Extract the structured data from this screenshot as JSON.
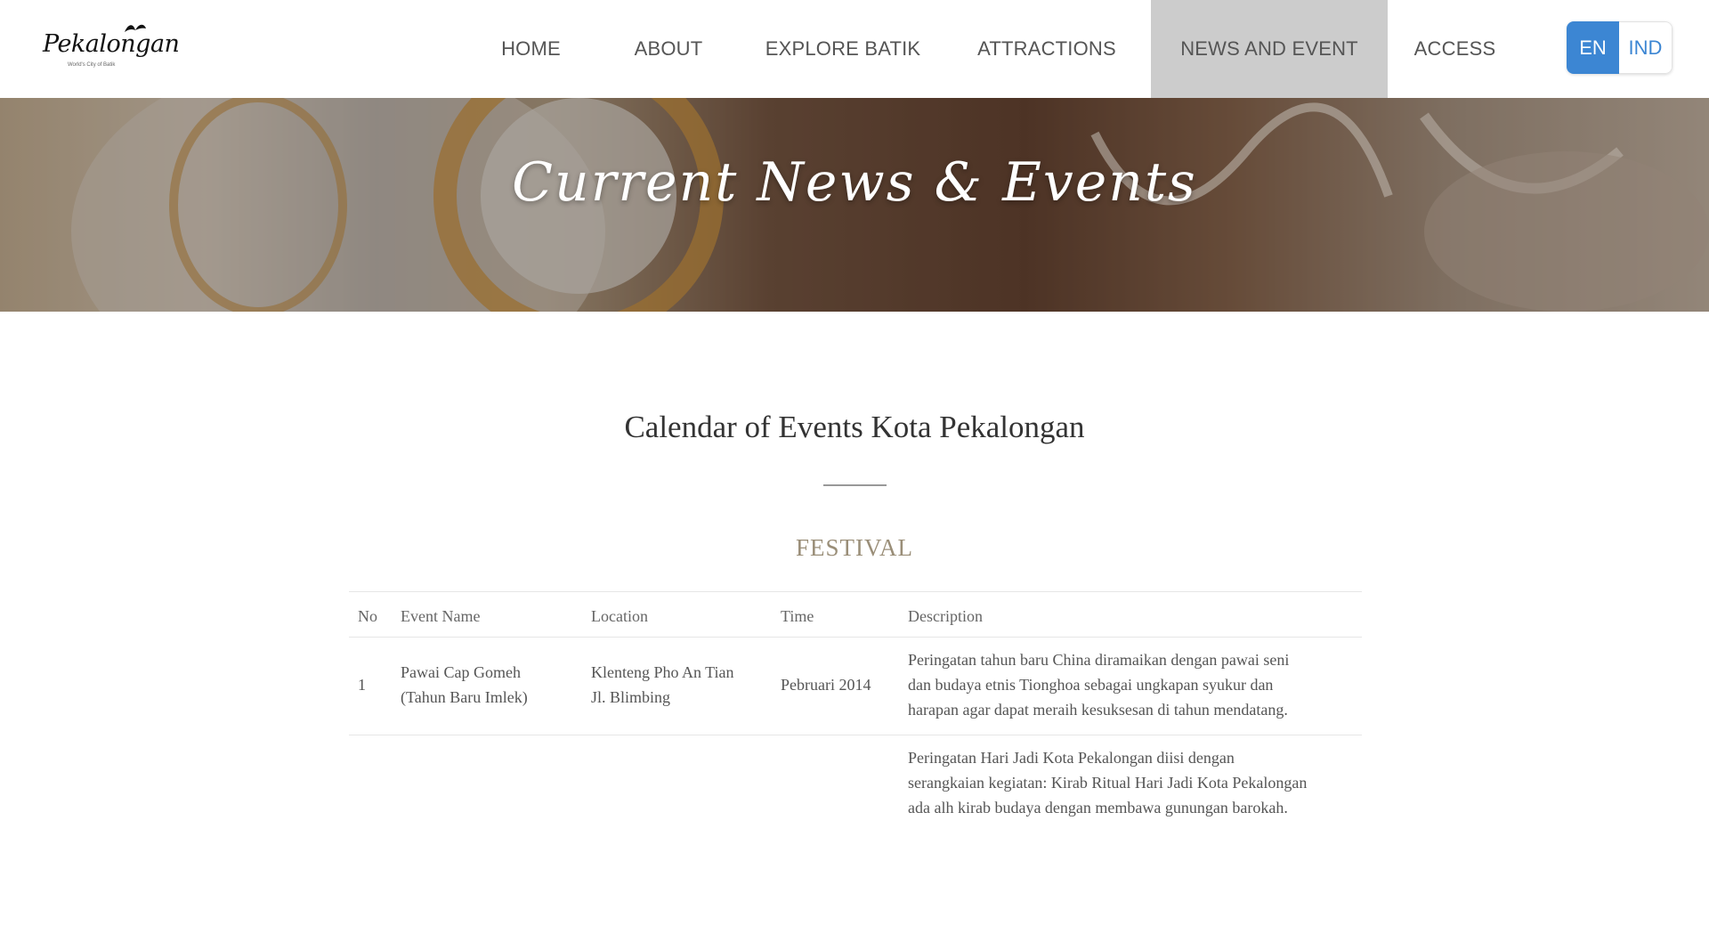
{
  "logo": {
    "text": "Pekalongan",
    "tagline": "World's City of Batik"
  },
  "nav": {
    "items": [
      {
        "label": "HOME"
      },
      {
        "label": "ABOUT"
      },
      {
        "label": "EXPLORE BATIK"
      },
      {
        "label": "ATTRACTIONS"
      },
      {
        "label": "NEWS AND EVENT",
        "active": true
      },
      {
        "label": "ACCESS"
      }
    ],
    "active_color": "#cccccc"
  },
  "lang": {
    "en": "EN",
    "ind": "IND",
    "accent": "#3c86d3"
  },
  "banner": {
    "title": "Current News & Events"
  },
  "main": {
    "title": "Calendar of Events Kota Pekalongan",
    "category": "FESTIVAL",
    "table": {
      "headers": {
        "no": "No",
        "name": "Event Name",
        "location": "Location",
        "time": "Time",
        "description": "Description"
      },
      "rows": [
        {
          "no": "1",
          "name_lines": [
            "Pawai Cap Gomeh",
            "(Tahun Baru Imlek)"
          ],
          "location_lines": [
            "Klenteng Pho An Tian",
            "Jl. Blimbing"
          ],
          "time": "Pebruari 2014",
          "description_lines": [
            "Peringatan tahun baru China diramaikan dengan pawai seni",
            "dan budaya etnis Tionghoa sebagai ungkapan syukur dan",
            "harapan agar dapat meraih kesuksesan di tahun mendatang."
          ]
        },
        {
          "no": "",
          "name_lines": [],
          "location_lines": [],
          "time": "",
          "description_lines": [
            "Peringatan Hari Jadi Kota Pekalongan diisi dengan",
            "serangkaian kegiatan: Kirab Ritual Hari Jadi Kota Pekalongan",
            "ada alh kirab budaya dengan membawa gunungan barokah."
          ]
        }
      ]
    }
  }
}
